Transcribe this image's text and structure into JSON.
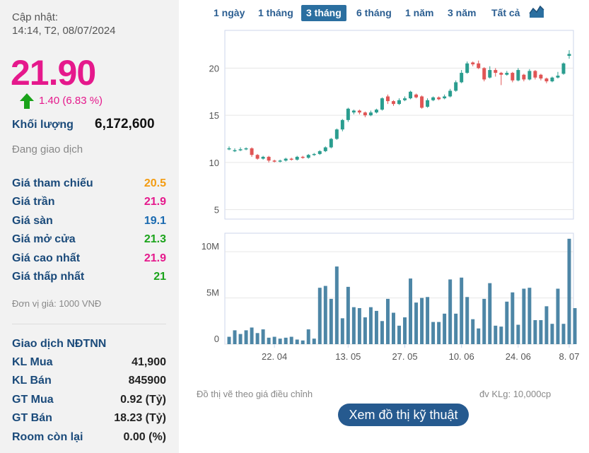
{
  "info": {
    "update_label": "Cập nhật:",
    "update_time": "14:14, T2, 08/07/2024",
    "price": "21.90",
    "change": "1.40 (6.83 %)",
    "volume_label": "Khối lượng",
    "volume_value": "6,172,600",
    "status": "Đang giao dịch",
    "unit": "Đơn vị giá: 1000 VNĐ",
    "colors": {
      "up": "#1aa31a",
      "down": "#d33",
      "ceiling": "#e5198c",
      "floor": "#1a6ab0",
      "ref": "#f39c12"
    }
  },
  "prices": [
    {
      "label": "Giá tham chiếu",
      "value": "20.5",
      "color": "#f39c12"
    },
    {
      "label": "Giá trần",
      "value": "21.9",
      "color": "#e5198c"
    },
    {
      "label": "Giá sàn",
      "value": "19.1",
      "color": "#1a6ab0"
    },
    {
      "label": "Giá mở cửa",
      "value": "21.3",
      "color": "#1aa31a"
    },
    {
      "label": "Giá cao nhất",
      "value": "21.9",
      "color": "#e5198c"
    },
    {
      "label": "Giá thấp nhất",
      "value": "21",
      "color": "#1aa31a"
    }
  ],
  "foreign": {
    "title": "Giao dịch NĐTNN",
    "rows": [
      {
        "label": "KL Mua",
        "value": "41,900"
      },
      {
        "label": "KL Bán",
        "value": "845900"
      },
      {
        "label": "GT Mua",
        "value": "0.92 (Tỷ)"
      },
      {
        "label": "GT Bán",
        "value": "18.23 (Tỷ)"
      },
      {
        "label": "Room còn lại",
        "value": "0.00 (%)"
      }
    ]
  },
  "tabs": [
    {
      "label": "1 ngày",
      "active": false
    },
    {
      "label": "1 tháng",
      "active": false
    },
    {
      "label": "3 tháng",
      "active": true
    },
    {
      "label": "6 tháng",
      "active": false
    },
    {
      "label": "1 năm",
      "active": false
    },
    {
      "label": "3 năm",
      "active": false
    },
    {
      "label": "Tất cả",
      "active": false
    }
  ],
  "chart_icon": "area-chart-icon",
  "footer": {
    "note": "Đồ thị vẽ theo giá điều chỉnh",
    "vol_unit": "đv KLg: 10,000cp",
    "button": "Xem đồ thị kỹ thuật"
  },
  "chart_data": [
    {
      "type": "candlestick",
      "y_ticks": [
        5,
        10,
        15,
        20
      ],
      "ylim": [
        4,
        24
      ],
      "colors": {
        "up": "#2a9d8f",
        "down": "#e05555"
      },
      "candles": [
        [
          11.5,
          11.5,
          11.3,
          11.7
        ],
        [
          11.3,
          11.3,
          11.1,
          11.5
        ],
        [
          11.3,
          11.4,
          11.2,
          11.6
        ],
        [
          11.4,
          11.5,
          11.3,
          11.6
        ],
        [
          11.5,
          10.8,
          10.6,
          11.6
        ],
        [
          10.8,
          10.4,
          10.3,
          10.9
        ],
        [
          10.4,
          10.6,
          10.3,
          10.7
        ],
        [
          10.6,
          10.2,
          10.0,
          10.7
        ],
        [
          10.2,
          10.1,
          10.0,
          10.3
        ],
        [
          10.1,
          10.2,
          10.0,
          10.3
        ],
        [
          10.2,
          10.4,
          10.1,
          10.5
        ],
        [
          10.4,
          10.3,
          10.2,
          10.5
        ],
        [
          10.3,
          10.6,
          10.2,
          10.7
        ],
        [
          10.6,
          10.5,
          10.4,
          10.7
        ],
        [
          10.5,
          10.8,
          10.4,
          10.9
        ],
        [
          10.8,
          10.9,
          10.7,
          11.0
        ],
        [
          10.9,
          11.2,
          10.8,
          11.3
        ],
        [
          11.2,
          11.6,
          11.1,
          11.7
        ],
        [
          11.6,
          12.5,
          11.5,
          12.6
        ],
        [
          12.5,
          13.5,
          12.4,
          13.6
        ],
        [
          13.5,
          14.5,
          13.3,
          14.6
        ],
        [
          14.5,
          15.7,
          14.3,
          15.8
        ],
        [
          15.3,
          15.5,
          15.1,
          15.6
        ],
        [
          15.5,
          15.3,
          15.1,
          15.6
        ],
        [
          15.3,
          15.0,
          14.8,
          15.4
        ],
        [
          15.0,
          15.3,
          14.9,
          15.5
        ],
        [
          15.3,
          15.6,
          15.2,
          15.7
        ],
        [
          15.6,
          16.8,
          15.5,
          16.9
        ],
        [
          17.0,
          16.5,
          16.2,
          17.2
        ],
        [
          16.5,
          16.2,
          16.0,
          16.6
        ],
        [
          16.2,
          16.6,
          16.1,
          16.8
        ],
        [
          16.6,
          16.8,
          16.5,
          17.0
        ],
        [
          16.8,
          17.5,
          16.7,
          17.6
        ],
        [
          17.2,
          16.9,
          16.8,
          17.3
        ],
        [
          17.0,
          15.8,
          15.7,
          17.1
        ],
        [
          15.9,
          16.6,
          15.8,
          16.8
        ],
        [
          16.6,
          16.9,
          16.5,
          17.0
        ],
        [
          16.9,
          16.7,
          16.6,
          17.0
        ],
        [
          16.8,
          17.0,
          16.7,
          17.2
        ],
        [
          17.0,
          17.6,
          16.9,
          17.8
        ],
        [
          17.6,
          18.5,
          17.5,
          18.7
        ],
        [
          18.5,
          19.5,
          18.4,
          19.8
        ],
        [
          19.5,
          20.5,
          19.4,
          20.7
        ],
        [
          20.6,
          20.4,
          20.2,
          20.7
        ],
        [
          20.5,
          20.0,
          19.9,
          20.8
        ],
        [
          20.0,
          18.8,
          18.6,
          20.1
        ],
        [
          19.0,
          19.8,
          18.9,
          20.2
        ],
        [
          19.8,
          19.5,
          19.1,
          20.0
        ],
        [
          19.5,
          19.3,
          18.2,
          19.6
        ],
        [
          19.3,
          19.5,
          19.2,
          19.7
        ],
        [
          19.5,
          18.7,
          18.5,
          19.6
        ],
        [
          18.7,
          19.8,
          18.6,
          20.0
        ],
        [
          19.3,
          18.8,
          18.6,
          19.4
        ],
        [
          18.8,
          19.7,
          18.7,
          19.9
        ],
        [
          19.7,
          19.0,
          18.8,
          19.8
        ],
        [
          19.3,
          18.9,
          18.7,
          19.4
        ],
        [
          18.9,
          18.6,
          18.4,
          19.0
        ],
        [
          18.6,
          19.0,
          18.5,
          19.1
        ],
        [
          19.0,
          19.2,
          18.9,
          19.6
        ],
        [
          19.4,
          20.5,
          19.3,
          20.6
        ],
        [
          21.3,
          21.5,
          21.0,
          21.9
        ]
      ]
    },
    {
      "type": "bar",
      "name": "volume",
      "y_ticks": [
        0,
        5,
        10
      ],
      "y_tick_labels": [
        "0",
        "5M",
        "10M"
      ],
      "x_ticks": [
        {
          "label": "22. 04",
          "index": 8
        },
        {
          "label": "13. 05",
          "index": 21
        },
        {
          "label": "27. 05",
          "index": 31
        },
        {
          "label": "10. 06",
          "index": 41
        },
        {
          "label": "24. 06",
          "index": 51
        },
        {
          "label": "8. 07",
          "index": 60
        }
      ],
      "ylim": [
        0,
        12
      ],
      "color": "#4d86a6",
      "values": [
        0.8,
        1.5,
        1.1,
        1.5,
        1.8,
        1.2,
        1.6,
        0.7,
        0.8,
        0.6,
        0.7,
        0.8,
        0.5,
        0.4,
        1.6,
        0.6,
        6.1,
        6.3,
        4.9,
        8.4,
        2.8,
        6.2,
        4.0,
        3.9,
        2.9,
        4.0,
        3.6,
        2.5,
        4.9,
        3.4,
        2.0,
        2.9,
        7.1,
        4.5,
        5.0,
        5.1,
        2.4,
        2.4,
        3.3,
        7.0,
        3.3,
        7.2,
        5.1,
        2.7,
        1.7,
        4.9,
        6.6,
        2.0,
        1.9,
        4.6,
        5.6,
        2.1,
        6.0,
        6.1,
        2.6,
        2.6,
        4.1,
        2.2,
        6.0,
        2.2,
        11.4,
        3.9
      ]
    }
  ]
}
